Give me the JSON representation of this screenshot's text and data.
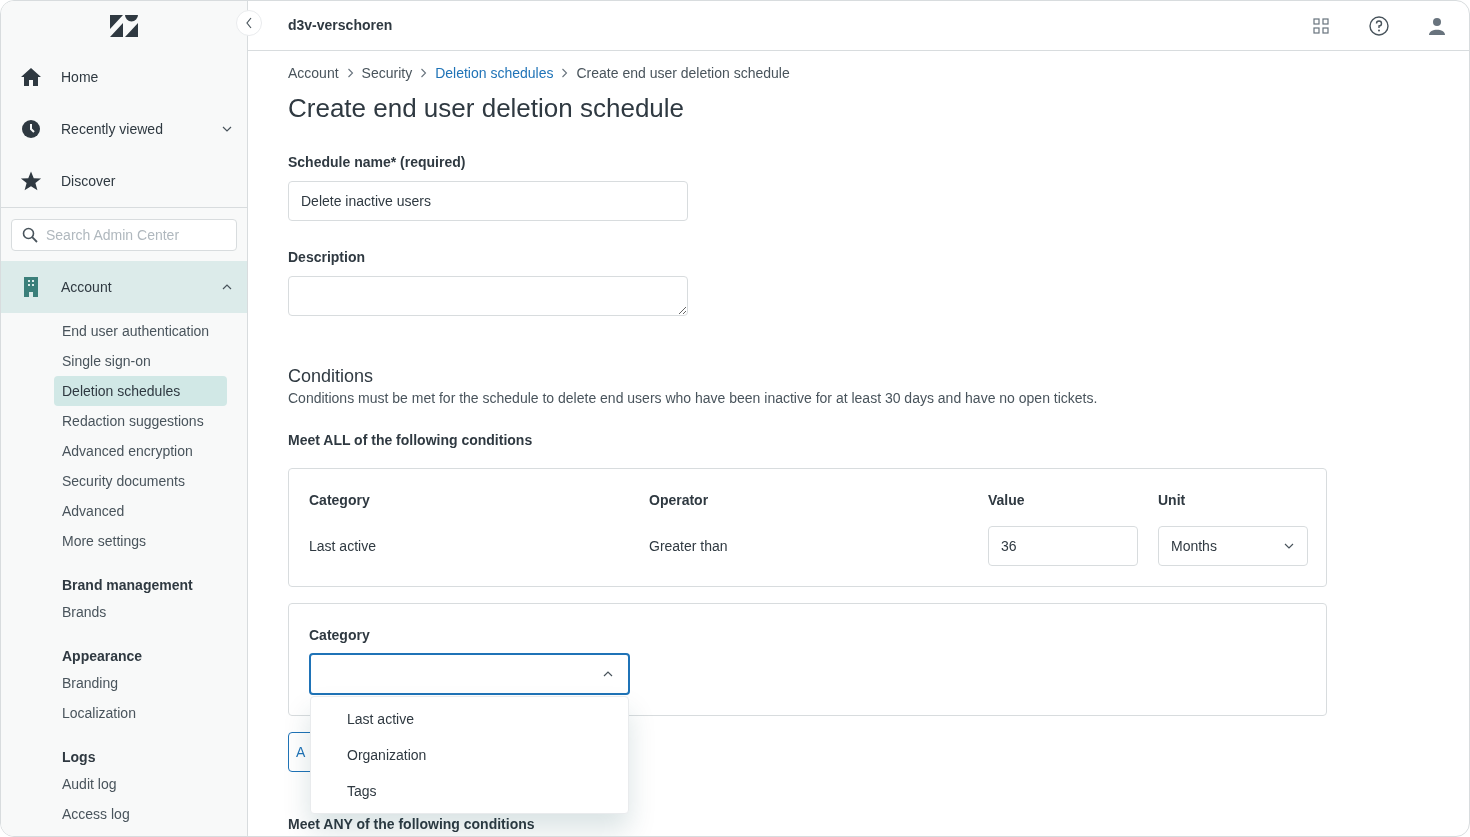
{
  "sidebar": {
    "nav": [
      {
        "label": "Home"
      },
      {
        "label": "Recently viewed",
        "expanded": false
      },
      {
        "label": "Discover"
      }
    ],
    "search": {
      "placeholder": "Search Admin Center"
    },
    "section": {
      "title": "Account",
      "expanded": true,
      "items": [
        {
          "label": "End user authentication",
          "selected": false
        },
        {
          "label": "Single sign-on",
          "selected": false
        },
        {
          "label": "Deletion schedules",
          "selected": true
        },
        {
          "label": "Redaction suggestions",
          "selected": false
        },
        {
          "label": "Advanced encryption",
          "selected": false
        },
        {
          "label": "Security documents",
          "selected": false
        },
        {
          "label": "Advanced",
          "selected": false
        },
        {
          "label": "More settings",
          "selected": false
        }
      ]
    },
    "groups": [
      {
        "title": "Brand management",
        "items": [
          "Brands"
        ]
      },
      {
        "title": "Appearance",
        "items": [
          "Branding",
          "Localization"
        ]
      },
      {
        "title": "Logs",
        "items": [
          "Audit log",
          "Access log"
        ]
      }
    ]
  },
  "header": {
    "workspace": "d3v-verschoren"
  },
  "breadcrumbs": [
    {
      "label": "Account",
      "link": false
    },
    {
      "label": "Security",
      "link": false
    },
    {
      "label": "Deletion schedules",
      "link": true
    },
    {
      "label": "Create end user deletion schedule",
      "link": false
    }
  ],
  "title": "Create end user deletion schedule",
  "fields": [
    {
      "label": "Schedule name* (required)",
      "value": "Delete inactive users",
      "kind": "input"
    },
    {
      "label": "Description",
      "kind": "textarea"
    }
  ],
  "conditions": {
    "heading": "Conditions",
    "description": "Conditions must be met for the schedule to delete end users who have been inactive for at least 30 days and have no open tickets.",
    "all_heading": "Meet ALL of the following conditions",
    "columns": [
      "Category",
      "Operator",
      "Value",
      "Unit"
    ],
    "row": {
      "category": "Last active",
      "operator": "Greater than",
      "value": "36",
      "unit": "Months"
    },
    "new_condition": {
      "label": "Category",
      "expanded": true,
      "options": [
        "Last active",
        "Organization",
        "Tags"
      ]
    },
    "add_button": "A",
    "any_heading": "Meet ANY of the following conditions"
  }
}
